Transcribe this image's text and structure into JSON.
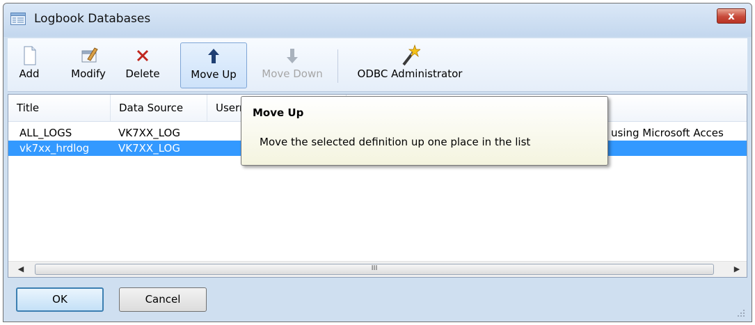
{
  "window": {
    "title": "Logbook Databases",
    "close_label": "x"
  },
  "toolbar": {
    "add": "Add",
    "modify": "Modify",
    "delete": "Delete",
    "move_up": "Move Up",
    "move_down": "Move Down",
    "odbc": "ODBC Administrator"
  },
  "list": {
    "columns": [
      "Title",
      "Data Source",
      "Usern"
    ],
    "rows": [
      {
        "title": "ALL_LOGS",
        "source": "VK7XX_LOG",
        "desc": "using Microsoft Acces"
      },
      {
        "title": "vk7xx_hrdlog",
        "source": "VK7XX_LOG",
        "desc": ""
      }
    ],
    "selected_row": 1,
    "scroll_grip": "III"
  },
  "tooltip": {
    "title": "Move Up",
    "text": "Move the selected definition up one place in the list"
  },
  "buttons": {
    "ok": "OK",
    "cancel": "Cancel"
  },
  "colors": {
    "selection": "#3399ff",
    "close": "#c7493a"
  },
  "icons": [
    "app-icon",
    "add-icon",
    "modify-icon",
    "delete-icon",
    "arrow-up-icon",
    "arrow-down-icon",
    "magic-wand-icon",
    "close-icon"
  ]
}
